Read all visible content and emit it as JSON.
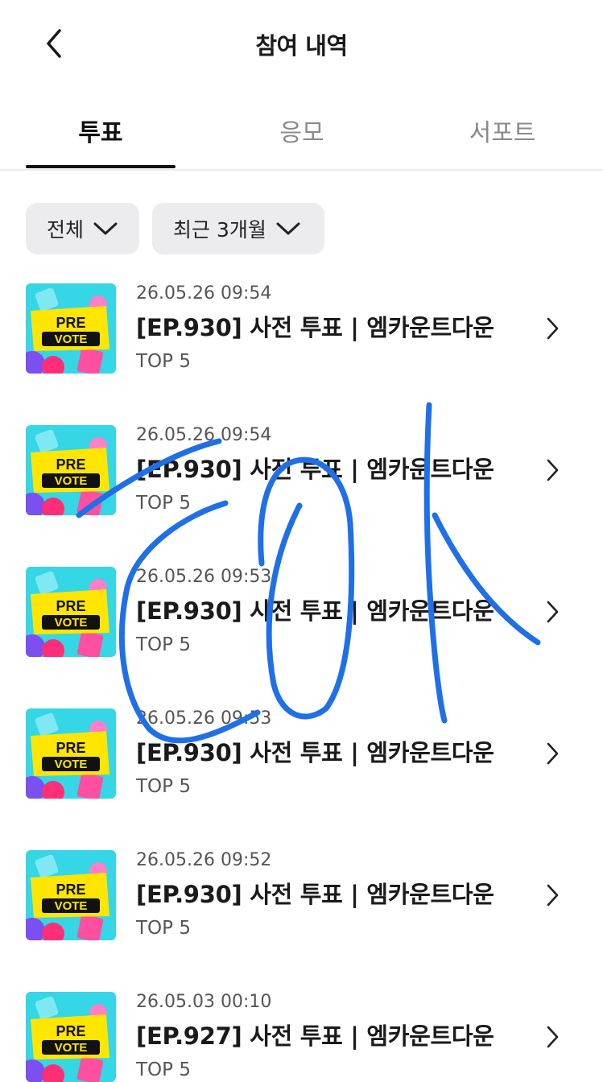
{
  "header": {
    "title": "참여 내역",
    "back_icon": "chevron-left-icon"
  },
  "tabs": [
    {
      "label": "투표",
      "active": true
    },
    {
      "label": "응모",
      "active": false
    },
    {
      "label": "서포트",
      "active": false
    }
  ],
  "filters": [
    {
      "label": "전체",
      "icon": "chevron-down-icon"
    },
    {
      "label": "최근 3개월",
      "icon": "chevron-down-icon"
    }
  ],
  "thumbnail": {
    "line1": "PRE",
    "line2": "VOTE"
  },
  "items": [
    {
      "date": "26.05.26 09:54",
      "title": "[EP.930] 사전 투표 | 엠카운트다운",
      "sub": "TOP 5"
    },
    {
      "date": "26.05.26 09:54",
      "title": "[EP.930] 사전 투표 | 엠카운트다운",
      "sub": "TOP 5"
    },
    {
      "date": "26.05.26 09:53",
      "title": "[EP.930] 사전 투표 | 엠카운트다운",
      "sub": "TOP 5"
    },
    {
      "date": "26.05.26 09:53",
      "title": "[EP.930] 사전 투표 | 엠카운트다운",
      "sub": "TOP 5"
    },
    {
      "date": "26.05.26 09:52",
      "title": "[EP.930] 사전 투표 | 엠카운트다운",
      "sub": "TOP 5"
    },
    {
      "date": "26.05.03 00:10",
      "title": "[EP.927] 사전 투표 | 엠카운트다운",
      "sub": "TOP 5"
    }
  ],
  "colors": {
    "accent": "#111111",
    "muted": "#8a8a8a",
    "filter_bg": "#ececef",
    "overlay_ink": "#1f6fe8"
  }
}
